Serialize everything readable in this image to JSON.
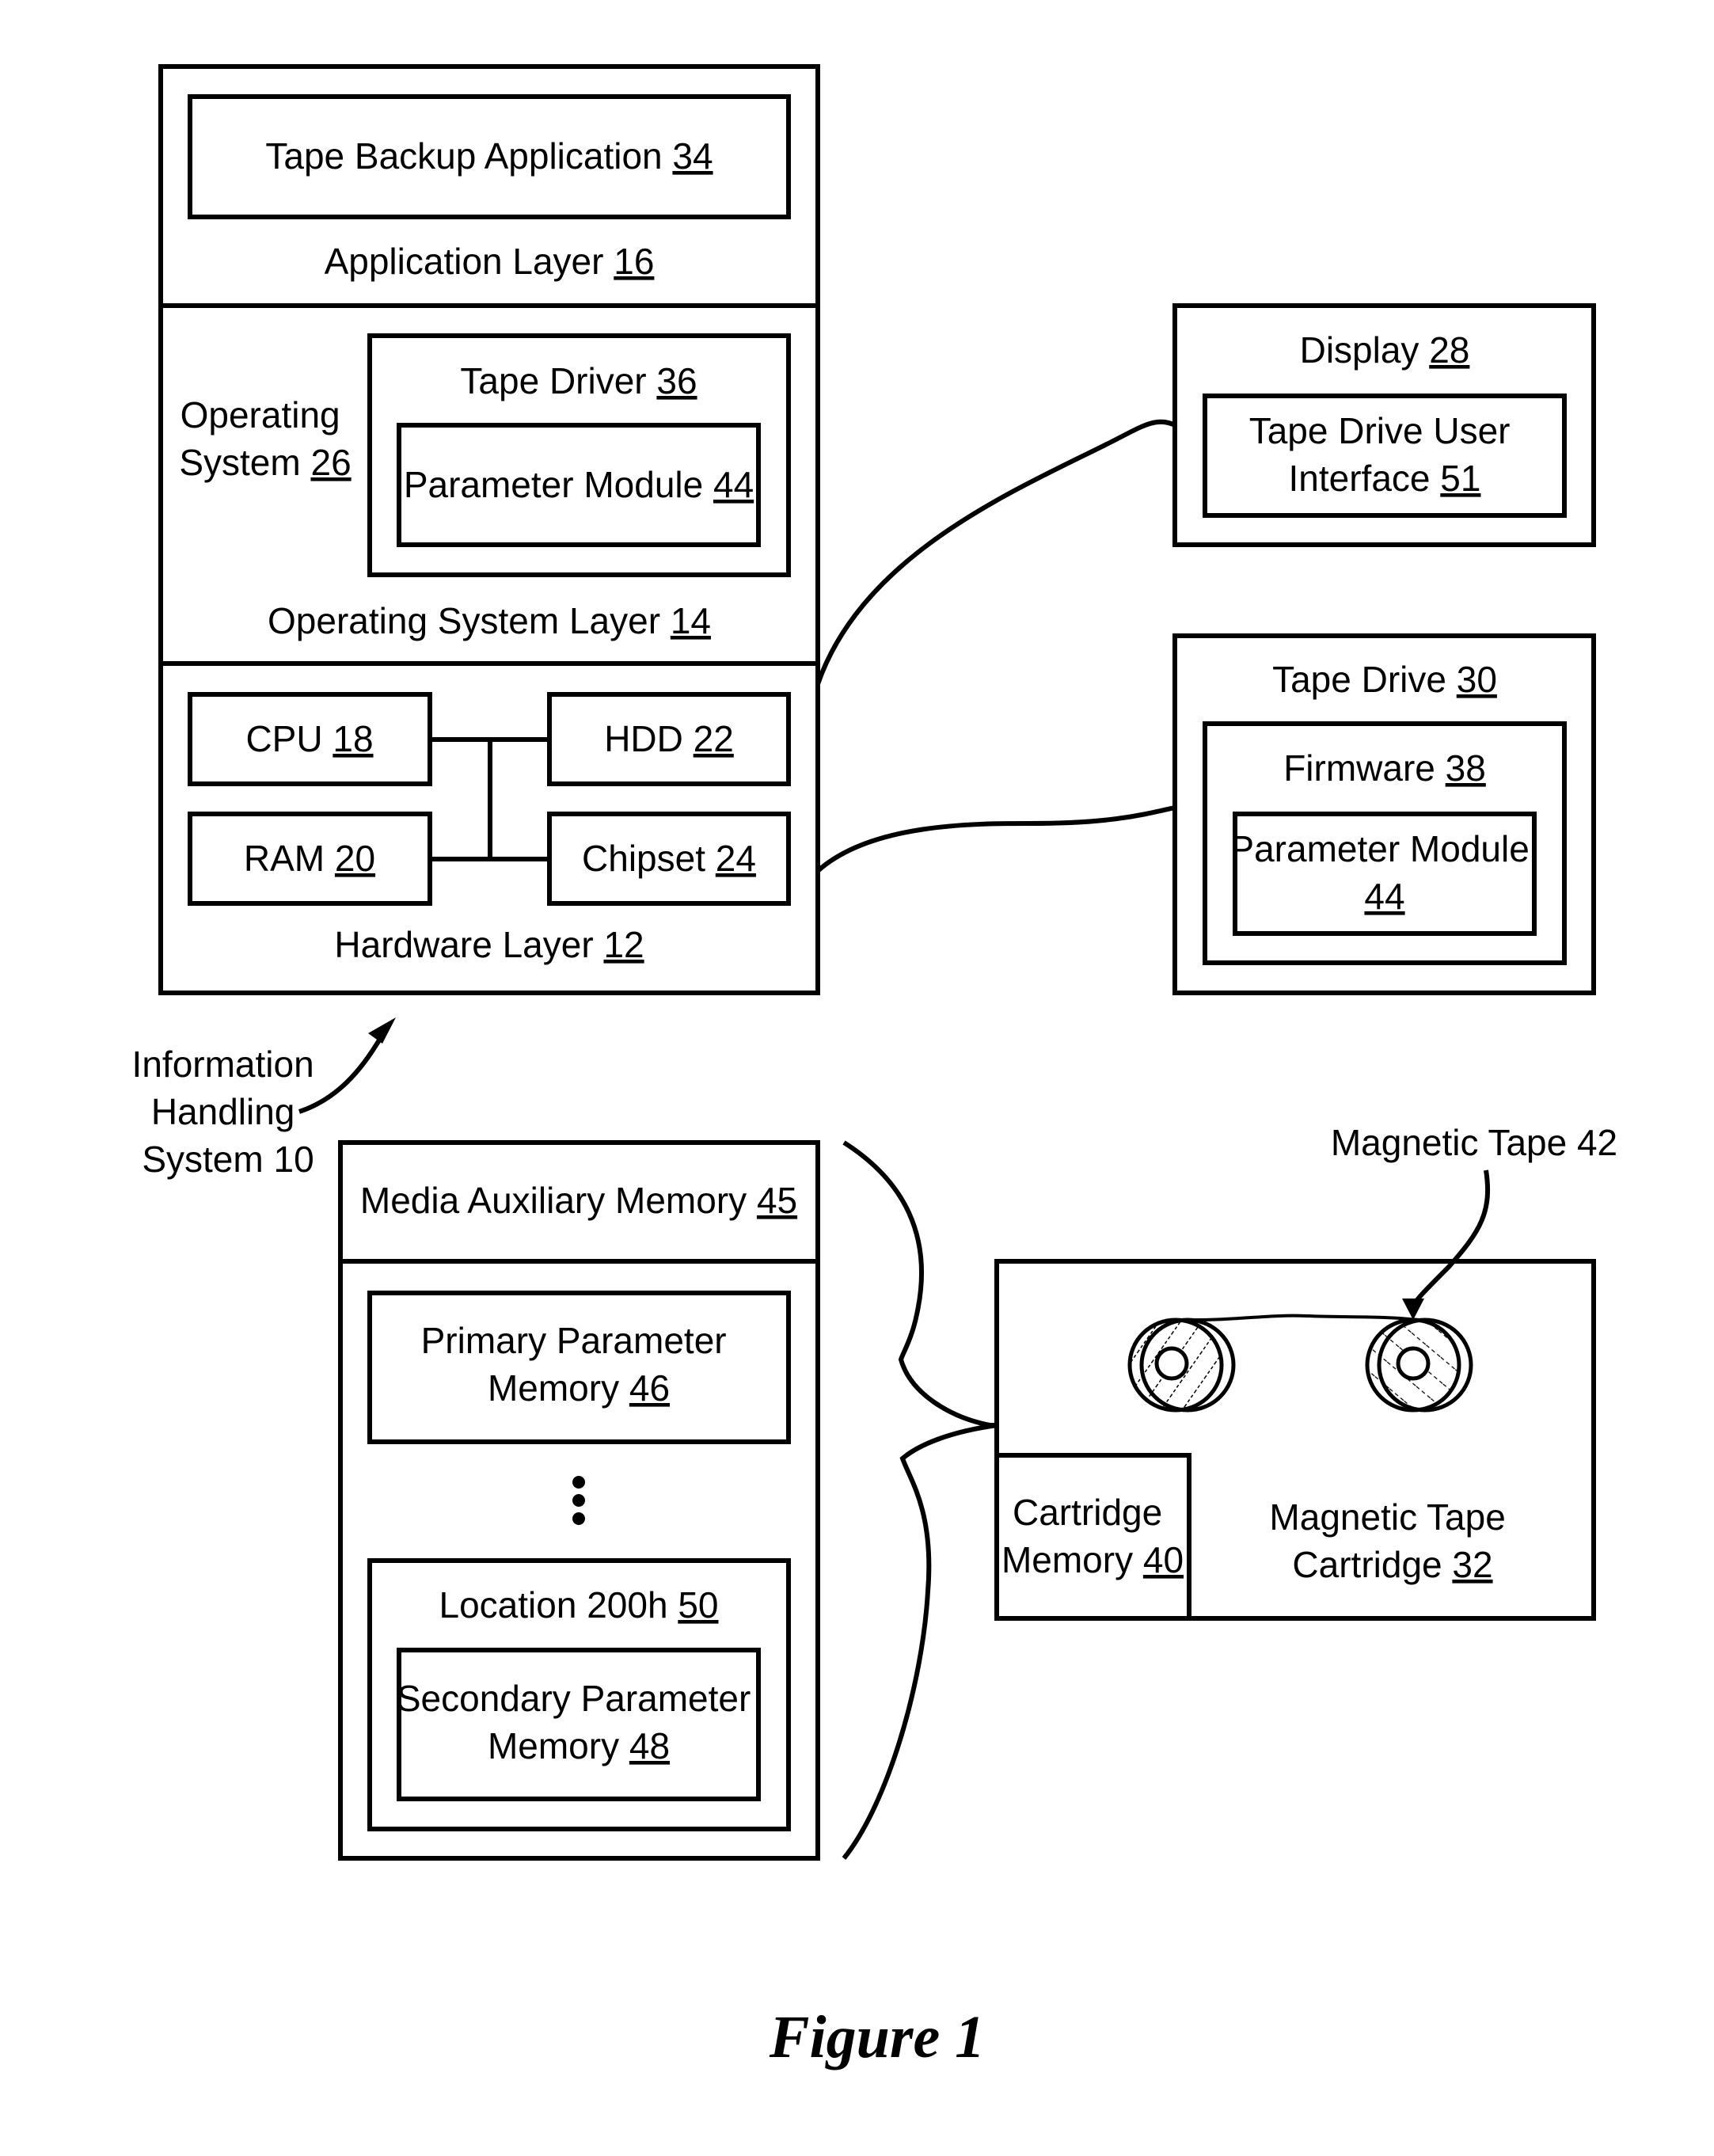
{
  "figure": {
    "caption": "Figure 1",
    "accent_color": "#000000",
    "background_color": "#ffffff"
  },
  "information_handling_system": {
    "label_lines": [
      "Information",
      "Handling",
      "System 10"
    ],
    "application_layer": {
      "text": "Application Layer ",
      "ref": "16",
      "tape_backup_application": {
        "text": "Tape Backup Application ",
        "ref": "34"
      }
    },
    "operating_system_layer": {
      "text": "Operating System Layer ",
      "ref": "14",
      "operating_system": {
        "line1": "Operating",
        "text": "System ",
        "ref": "26"
      },
      "tape_driver": {
        "text": "Tape Driver ",
        "ref": "36",
        "parameter_module": {
          "text": "Parameter Module ",
          "ref": "44"
        }
      }
    },
    "hardware_layer": {
      "text": "Hardware Layer ",
      "ref": "12",
      "cpu": {
        "text": "CPU ",
        "ref": "18"
      },
      "hdd": {
        "text": "HDD ",
        "ref": "22"
      },
      "ram": {
        "text": "RAM ",
        "ref": "20"
      },
      "chipset": {
        "text": "Chipset ",
        "ref": "24"
      }
    }
  },
  "display": {
    "text": "Display ",
    "ref": "28",
    "tape_drive_user_interface": {
      "line1": "Tape Drive User",
      "text": "Interface ",
      "ref": "51"
    }
  },
  "tape_drive": {
    "text": "Tape Drive ",
    "ref": "30",
    "firmware": {
      "text": "Firmware ",
      "ref": "38",
      "parameter_module": {
        "line1": "Parameter Module",
        "ref": "44"
      }
    }
  },
  "media_auxiliary_memory": {
    "text": "Media Auxiliary Memory ",
    "ref": "45",
    "primary_parameter_memory": {
      "line1": "Primary Parameter",
      "text": "Memory ",
      "ref": "46"
    },
    "ellipsis_icon": "vertical-ellipsis",
    "location": {
      "text": "Location 200h ",
      "ref": "50",
      "secondary_parameter_memory": {
        "line1": "Secondary Parameter",
        "text": "Memory ",
        "ref": "48"
      }
    }
  },
  "magnetic_tape_cartridge": {
    "line1": "Magnetic Tape",
    "text": "Cartridge ",
    "ref": "32",
    "cartridge_memory": {
      "line1": "Cartridge",
      "text": "Memory ",
      "ref": "40"
    },
    "magnetic_tape_label": "Magnetic Tape 42",
    "reel_icons": [
      "supply-reel",
      "take-up-reel"
    ]
  }
}
